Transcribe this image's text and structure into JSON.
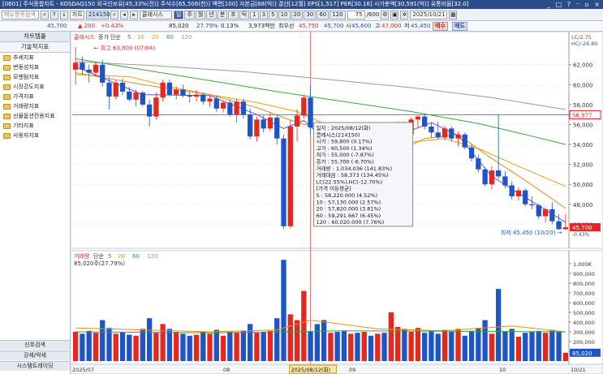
{
  "window": {
    "title": "[0601] 주식종합차트 - KOSDAQ150 외국인보유[45,33%(전)] 주식수[65,506(천)] 액면[100] 자본금[68(억)] 결산[12월] EPS[1,517] PER[30.16] 시가총액[30,591(억)] 유통비율[32.0]",
    "controls": "_ □ ? ⁻ ▫ ×"
  },
  "toolbar": {
    "search_placeholder": "메뉴항목검색",
    "code": "214150",
    "stock_name": "클래시스",
    "period_buttons": [
      "일",
      "주",
      "월",
      "년",
      "분",
      "초",
      "틱",
      "1",
      "3",
      "5",
      "10",
      "20",
      "30",
      "60",
      "120"
    ],
    "active_period": "일",
    "count": "75",
    "count_total": "/600",
    "date": "2025/10/21",
    "chart_label": "차트"
  },
  "quote": {
    "price": "45,700",
    "change": "▲ 200",
    "change_rate": "+0.43%",
    "volume": "85,020",
    "turnover": "27.79%",
    "ratio": "0.13%",
    "amount": "3,973백만",
    "best_ask_label": "최우선",
    "best_ask": "45,750",
    "best_bid": "45,700",
    "open_label": "시",
    "open": "45,600",
    "high_label": "고",
    "high": "47,000",
    "low_label": "저",
    "low": "45,450",
    "buy_button": "매수",
    "sell_button": "매도"
  },
  "sidebar": {
    "header": "차트템플",
    "section": "기술적지표",
    "items": [
      "추세지표",
      "변동성지표",
      "모멘텀지표",
      "시장강도지표",
      "가격지표",
      "거래량지표",
      "선물옵션전용지표",
      "기타지표",
      "사용자지표"
    ],
    "bottom_items": [
      "신호검색",
      "강세/약세",
      "시스템트레이딩"
    ]
  },
  "colors": {
    "up": "#e6261f",
    "down": "#1e54c6",
    "ma5": "#6a4fd4",
    "ma10": "#e98d1d",
    "ma20": "#e0a21c",
    "ma60": "#3ea33b",
    "ma120": "#9a9a9a"
  },
  "chart_data": [
    {
      "type": "candlestick",
      "legend": [
        "클래시스",
        "종가 단순",
        "5",
        "10",
        "20",
        "60",
        "120"
      ],
      "y_ticks": [
        "62,000",
        "60,000",
        "58,000",
        "56,000",
        "54,000",
        "52,000",
        "50,000",
        "48,000",
        "46,000"
      ],
      "y_range": [
        44000,
        64500
      ],
      "x_ticks": [
        "2025/07",
        "08",
        "2025/08/12(화)",
        "09",
        "10"
      ],
      "current_price": "56,977",
      "last_price": "45,700",
      "last_sub": "-0.43%",
      "top_right_1": "LC/2.75",
      "top_right_2": "HC/-26.80",
      "max_annotation": "최고 63,800 (07/04)",
      "min_annotation": "최저 45,450 (10/20)",
      "candles": [
        {
          "o": 61500,
          "h": 63800,
          "l": 60000,
          "c": 62200
        },
        {
          "o": 62200,
          "h": 62800,
          "l": 61000,
          "c": 61500
        },
        {
          "o": 61500,
          "h": 62000,
          "l": 60200,
          "c": 61200
        },
        {
          "o": 61200,
          "h": 62300,
          "l": 60800,
          "c": 62000
        },
        {
          "o": 62000,
          "h": 62500,
          "l": 59800,
          "c": 60200
        },
        {
          "o": 60200,
          "h": 60800,
          "l": 57500,
          "c": 58800
        },
        {
          "o": 58800,
          "h": 60500,
          "l": 58500,
          "c": 60200
        },
        {
          "o": 60200,
          "h": 60600,
          "l": 59000,
          "c": 59300
        },
        {
          "o": 59300,
          "h": 59800,
          "l": 58300,
          "c": 58500
        },
        {
          "o": 58500,
          "h": 59500,
          "l": 57800,
          "c": 59200
        },
        {
          "o": 59200,
          "h": 59400,
          "l": 57800,
          "c": 58000
        },
        {
          "o": 58000,
          "h": 58500,
          "l": 55800,
          "c": 56800
        },
        {
          "o": 56800,
          "h": 59200,
          "l": 56500,
          "c": 58700
        },
        {
          "o": 58700,
          "h": 60500,
          "l": 58300,
          "c": 60200
        },
        {
          "o": 60200,
          "h": 60500,
          "l": 58800,
          "c": 59000
        },
        {
          "o": 59000,
          "h": 59800,
          "l": 58500,
          "c": 59500
        },
        {
          "o": 59500,
          "h": 60000,
          "l": 58700,
          "c": 58900
        },
        {
          "o": 58900,
          "h": 59300,
          "l": 58200,
          "c": 58800
        },
        {
          "o": 58800,
          "h": 59500,
          "l": 58300,
          "c": 59000
        },
        {
          "o": 59000,
          "h": 59200,
          "l": 58000,
          "c": 58300
        },
        {
          "o": 58300,
          "h": 58900,
          "l": 57800,
          "c": 58600
        },
        {
          "o": 58600,
          "h": 58900,
          "l": 57300,
          "c": 57600
        },
        {
          "o": 57600,
          "h": 58400,
          "l": 57200,
          "c": 58200
        },
        {
          "o": 58200,
          "h": 58500,
          "l": 56800,
          "c": 57000
        },
        {
          "o": 57000,
          "h": 58600,
          "l": 56200,
          "c": 58300
        },
        {
          "o": 58300,
          "h": 58600,
          "l": 56600,
          "c": 57000
        },
        {
          "o": 57000,
          "h": 57600,
          "l": 54500,
          "c": 54800
        },
        {
          "o": 54800,
          "h": 56800,
          "l": 54300,
          "c": 56500
        },
        {
          "o": 56500,
          "h": 56900,
          "l": 55200,
          "c": 55600
        },
        {
          "o": 55600,
          "h": 57200,
          "l": 55300,
          "c": 56700
        },
        {
          "o": 56700,
          "h": 57000,
          "l": 54000,
          "c": 54600
        },
        {
          "o": 54600,
          "h": 55000,
          "l": 45500,
          "c": 45800
        },
        {
          "o": 45800,
          "h": 56500,
          "l": 45600,
          "c": 55800
        },
        {
          "o": 55800,
          "h": 57500,
          "l": 54300,
          "c": 56900
        },
        {
          "o": 56900,
          "h": 59000,
          "l": 56600,
          "c": 58700
        },
        {
          "o": 58700,
          "h": 59900,
          "l": 55000,
          "c": 55700
        },
        {
          "o": 55700,
          "h": 56200,
          "l": 53200,
          "c": 53600
        },
        {
          "o": 53600,
          "h": 54000,
          "l": 51500,
          "c": 51900
        },
        {
          "o": 51900,
          "h": 52800,
          "l": 51200,
          "c": 52500
        },
        {
          "o": 52500,
          "h": 53000,
          "l": 51700,
          "c": 52000
        },
        {
          "o": 52000,
          "h": 52300,
          "l": 51000,
          "c": 51600
        },
        {
          "o": 51600,
          "h": 52600,
          "l": 51400,
          "c": 52400
        },
        {
          "o": 52400,
          "h": 52900,
          "l": 51800,
          "c": 52100
        },
        {
          "o": 52100,
          "h": 53300,
          "l": 51900,
          "c": 53000
        },
        {
          "o": 53000,
          "h": 53300,
          "l": 52000,
          "c": 52300
        },
        {
          "o": 52300,
          "h": 53200,
          "l": 52100,
          "c": 52900
        },
        {
          "o": 52900,
          "h": 53500,
          "l": 52200,
          "c": 52500
        },
        {
          "o": 52500,
          "h": 55800,
          "l": 52400,
          "c": 55500
        },
        {
          "o": 55500,
          "h": 56300,
          "l": 54800,
          "c": 55800
        },
        {
          "o": 55800,
          "h": 56300,
          "l": 54700,
          "c": 55000
        },
        {
          "o": 55000,
          "h": 56700,
          "l": 54800,
          "c": 56500
        },
        {
          "o": 56500,
          "h": 57000,
          "l": 55700,
          "c": 56800
        },
        {
          "o": 56800,
          "h": 57000,
          "l": 55500,
          "c": 55800
        },
        {
          "o": 55800,
          "h": 56200,
          "l": 54700,
          "c": 55200
        },
        {
          "o": 55200,
          "h": 56300,
          "l": 54500,
          "c": 54700
        },
        {
          "o": 54700,
          "h": 55900,
          "l": 54400,
          "c": 55600
        },
        {
          "o": 55600,
          "h": 55800,
          "l": 54300,
          "c": 54600
        },
        {
          "o": 54600,
          "h": 55300,
          "l": 53800,
          "c": 55000
        },
        {
          "o": 55000,
          "h": 55200,
          "l": 53500,
          "c": 53700
        },
        {
          "o": 53700,
          "h": 54000,
          "l": 52300,
          "c": 52600
        },
        {
          "o": 52600,
          "h": 53000,
          "l": 51200,
          "c": 51500
        },
        {
          "o": 51500,
          "h": 51700,
          "l": 49800,
          "c": 50000
        },
        {
          "o": 50000,
          "h": 51800,
          "l": 49500,
          "c": 51400
        },
        {
          "o": 51400,
          "h": 57000,
          "l": 50500,
          "c": 50800
        },
        {
          "o": 50800,
          "h": 51300,
          "l": 49600,
          "c": 49900
        },
        {
          "o": 49900,
          "h": 50300,
          "l": 48500,
          "c": 48800
        },
        {
          "o": 48800,
          "h": 49700,
          "l": 48400,
          "c": 49400
        },
        {
          "o": 49400,
          "h": 49600,
          "l": 47800,
          "c": 48000
        },
        {
          "o": 48000,
          "h": 48800,
          "l": 47500,
          "c": 47900
        },
        {
          "o": 47900,
          "h": 48100,
          "l": 46500,
          "c": 46800
        },
        {
          "o": 46800,
          "h": 47700,
          "l": 46200,
          "c": 47500
        },
        {
          "o": 47500,
          "h": 48200,
          "l": 46000,
          "c": 46300
        },
        {
          "o": 46300,
          "h": 47000,
          "l": 45450,
          "c": 45500
        },
        {
          "o": 45500,
          "h": 47000,
          "l": 45450,
          "c": 45700
        }
      ],
      "ma": {
        "ma5": [
          [
            0,
            61800
          ],
          [
            10,
            59000
          ],
          [
            20,
            58900
          ],
          [
            27,
            57000
          ],
          [
            31,
            55600
          ],
          [
            34,
            56400
          ],
          [
            36,
            55200
          ],
          [
            40,
            52800
          ],
          [
            46,
            52700
          ],
          [
            50,
            55400
          ],
          [
            53,
            56200
          ],
          [
            57,
            54900
          ],
          [
            62,
            50800
          ],
          [
            67,
            48700
          ],
          [
            73,
            46200
          ]
        ],
        "ma10": [
          [
            0,
            61200
          ],
          [
            10,
            60000
          ],
          [
            20,
            59000
          ],
          [
            27,
            57700
          ],
          [
            33,
            56200
          ],
          [
            37,
            55500
          ],
          [
            42,
            53700
          ],
          [
            48,
            53300
          ],
          [
            52,
            54600
          ],
          [
            57,
            55000
          ],
          [
            62,
            52600
          ],
          [
            67,
            50400
          ],
          [
            73,
            47600
          ]
        ],
        "ma20": [
          [
            0,
            61000
          ],
          [
            8,
            60800
          ],
          [
            14,
            59800
          ],
          [
            20,
            59000
          ],
          [
            27,
            58200
          ],
          [
            33,
            57300
          ],
          [
            40,
            55200
          ],
          [
            47,
            54000
          ],
          [
            55,
            54600
          ],
          [
            60,
            53600
          ],
          [
            66,
            51800
          ],
          [
            73,
            49800
          ]
        ],
        "ma60": [
          [
            0,
            62600
          ],
          [
            10,
            61500
          ],
          [
            20,
            60400
          ],
          [
            30,
            59300
          ],
          [
            40,
            58300
          ],
          [
            50,
            57300
          ],
          [
            60,
            56100
          ],
          [
            67,
            55000
          ],
          [
            73,
            54000
          ]
        ],
        "ma120": [
          [
            0,
            62300
          ],
          [
            12,
            61900
          ],
          [
            25,
            61300
          ],
          [
            38,
            60500
          ],
          [
            50,
            59700
          ],
          [
            62,
            58700
          ],
          [
            73,
            57500
          ]
        ]
      }
    },
    {
      "type": "bar",
      "legend": [
        "거래량",
        "단순",
        "5",
        "20",
        "60",
        "120"
      ],
      "subtitle": "85,020주(27.79%)",
      "y_ticks": [
        "1,000K",
        "900,000",
        "800,000",
        "700,000",
        "600,000",
        "500,000",
        "400,000",
        "300,000",
        "200,000",
        "100,000"
      ],
      "y_range": [
        0,
        1050000
      ],
      "last_volume": "85,020",
      "volumes": [
        300000,
        280000,
        310000,
        290000,
        420000,
        340000,
        280000,
        300000,
        270000,
        260000,
        330000,
        440000,
        290000,
        380000,
        330000,
        300000,
        280000,
        260000,
        270000,
        300000,
        280000,
        320000,
        260000,
        300000,
        290000,
        310000,
        380000,
        290000,
        300000,
        310000,
        440000,
        1040000,
        480000,
        420000,
        720000,
        300000,
        380000,
        420000,
        290000,
        300000,
        310000,
        280000,
        290000,
        300000,
        260000,
        280000,
        290000,
        500000,
        350000,
        330000,
        300000,
        340000,
        290000,
        310000,
        280000,
        320000,
        300000,
        330000,
        260000,
        310000,
        340000,
        420000,
        280000,
        740000,
        300000,
        330000,
        250000,
        290000,
        300000,
        310000,
        290000,
        320000,
        300000,
        85020
      ]
    }
  ],
  "tooltip": {
    "lines": [
      "일자       : 2025/08/12(화)",
      "클래시스(214150)",
      "시가       : 59,800 (0.17%)",
      "고가       : 60,500 (1.34%)",
      "저가       : 55,000 (-7.87%)",
      "종가       : 55,700 (-6.70%)",
      "거래량     : 1,034,036 (141.83%)",
      "거래대금   : 58,373 (134.45%)",
      "LC(22.55%),HC(-12.70%)",
      "[가격 이동평균]",
      "5    : 58,220.000 (4.52%)",
      "10   : 57,130.000 (2.57%)",
      "20   : 57,820.000 (3.81%)",
      "60   : 59,291.667 (6.45%)",
      "120  : 60,020.000 (7.76%)"
    ]
  },
  "bottom_axis": {
    "labels": [
      "2025/07",
      "08",
      "2025/08/12(화)",
      "09",
      "10",
      "10/21"
    ]
  }
}
